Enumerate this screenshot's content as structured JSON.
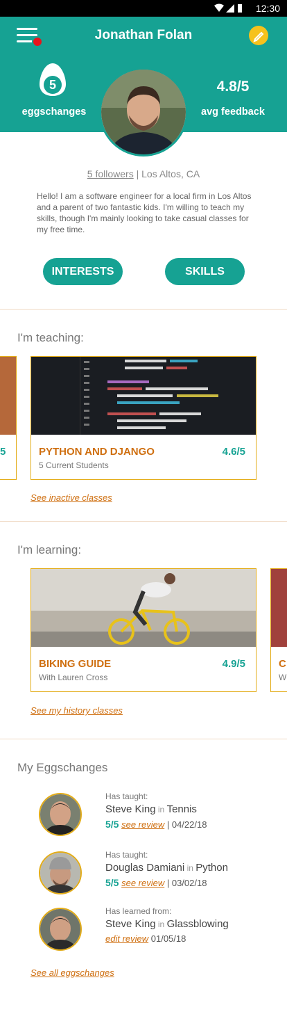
{
  "status_bar": {
    "time": "12:30"
  },
  "profile": {
    "name": "Jonathan Folan",
    "eggschanges_count": "5",
    "eggschanges_label": "eggschanges",
    "rating": "4.8/5",
    "rating_label": "avg feedback",
    "followers": "5 followers",
    "location": " | Los Altos, CA",
    "bio": "Hello! I am a software engineer for a local firm in Los Altos and a parent of two fantastic kids. I'm willing to teach my skills, though I'm mainly looking to take casual classes for my free time."
  },
  "buttons": {
    "interests": "INTERESTS",
    "skills": "SKILLS"
  },
  "teaching": {
    "heading": "I'm teaching:",
    "prev_card_rating_fragment": "5",
    "card": {
      "title": "PYTHON AND DJANGO",
      "rating": "4.6/5",
      "sub": "5 Current Students"
    },
    "link": "See inactive classes"
  },
  "learning": {
    "heading": "I'm learning:",
    "card": {
      "title": "BIKING GUIDE",
      "rating": "4.9/5",
      "sub": "With Lauren Cross"
    },
    "next_card_fragment_title": "C",
    "next_card_fragment_sub": "W",
    "link": "See my history classes"
  },
  "eggschanges": {
    "heading": "My Eggschanges",
    "items": [
      {
        "kind": "Has taught:",
        "person": "Steve King",
        "in": " in ",
        "subject": "Tennis",
        "score": "5/5",
        "link": "see review",
        "date": " | 04/22/18"
      },
      {
        "kind": "Has taught:",
        "person": "Douglas Damiani",
        "in": " in ",
        "subject": "Python",
        "score": "5/5",
        "link": "see review",
        "date": " | 03/02/18"
      },
      {
        "kind": "Has learned from:",
        "person": "Steve King",
        "in": " in ",
        "subject": "Glassblowing",
        "score": "",
        "link": "edit review",
        "date": " 01/05/18"
      }
    ],
    "link": "See all eggschanges"
  },
  "colors": {
    "teal": "#16a293",
    "orange": "#cf6f10",
    "gold": "#e3ac17",
    "badge_red": "#e8141c"
  }
}
